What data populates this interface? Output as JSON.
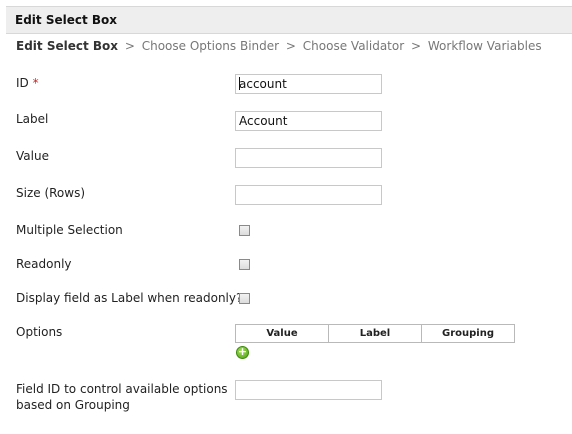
{
  "dialog": {
    "title": "Edit Select Box"
  },
  "breadcrumb": {
    "current": "Edit Select Box",
    "separator": ">",
    "steps": [
      "Choose Options Binder",
      "Choose Validator",
      "Workflow Variables"
    ]
  },
  "fields": {
    "id": {
      "label": "ID",
      "required_marker": "*",
      "value": "account"
    },
    "label": {
      "label": "Label",
      "value": "Account"
    },
    "value": {
      "label": "Value",
      "value": ""
    },
    "size": {
      "label": "Size (Rows)",
      "value": ""
    },
    "multiple": {
      "label": "Multiple Selection",
      "checked": false
    },
    "readonly": {
      "label": "Readonly",
      "checked": false
    },
    "display_as_label": {
      "label": "Display field as Label when readonly?",
      "checked": false
    },
    "options": {
      "label": "Options",
      "columns": [
        "Value",
        "Label",
        "Grouping"
      ],
      "add_icon": "plus-circle-icon"
    },
    "grouping_control": {
      "label_line1": "Field ID to control available options",
      "label_line2": "based on Grouping",
      "value": ""
    }
  },
  "colors": {
    "required": "#d21f1f",
    "add_button": "#5aa81c",
    "titlebar_bg": "#eeeeee"
  }
}
